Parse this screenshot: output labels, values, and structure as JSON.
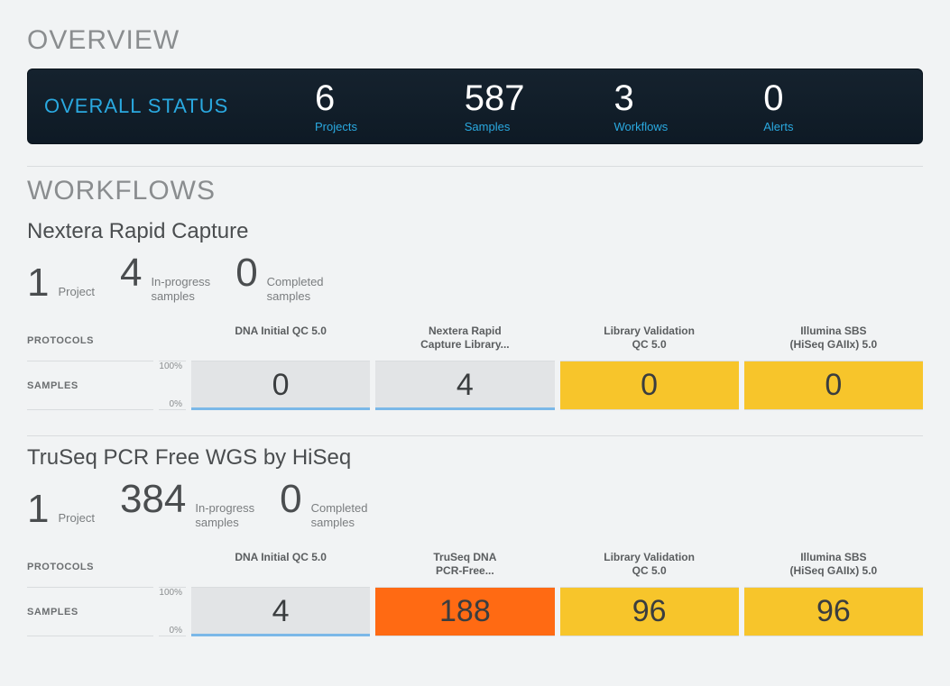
{
  "overview": {
    "title": "OVERVIEW",
    "status_label": "OVERALL STATUS",
    "stats": {
      "projects": {
        "num": "6",
        "cap": "Projects"
      },
      "samples": {
        "num": "587",
        "cap": "Samples"
      },
      "workflows": {
        "num": "3",
        "cap": "Workflows"
      },
      "alerts": {
        "num": "0",
        "cap": "Alerts"
      }
    }
  },
  "workflows_title": "WORKFLOWS",
  "axis": {
    "top": "100%",
    "bottom": "0%"
  },
  "row_labels": {
    "protocols": "PROTOCOLS",
    "samples": "SAMPLES"
  },
  "wf1": {
    "name": "Nextera Rapid Capture",
    "stats": {
      "projects": {
        "num": "1",
        "label": "Project"
      },
      "inprogress": {
        "num": "4",
        "label": "In-progress\nsamples"
      },
      "completed": {
        "num": "0",
        "label": "Completed\nsamples"
      }
    },
    "protocols": {
      "p1": "DNA Initial QC 5.0",
      "p2": "Nextera Rapid\nCapture Library...",
      "p3": "Library Validation\nQC 5.0",
      "p4": "Illumina SBS\n(HiSeq GAIIx) 5.0"
    },
    "values": {
      "v1": "0",
      "v2": "4",
      "v3": "0",
      "v4": "0"
    }
  },
  "wf2": {
    "name": "TruSeq PCR Free WGS by HiSeq",
    "stats": {
      "projects": {
        "num": "1",
        "label": "Project"
      },
      "inprogress": {
        "num": "384",
        "label": "In-progress\nsamples"
      },
      "completed": {
        "num": "0",
        "label": "Completed\nsamples"
      }
    },
    "protocols": {
      "p1": "DNA Initial QC 5.0",
      "p2": "TruSeq DNA\nPCR-Free...",
      "p3": "Library Validation\nQC 5.0",
      "p4": "Illumina SBS\n(HiSeq GAIIx) 5.0"
    },
    "values": {
      "v1": "4",
      "v2": "188",
      "v3": "96",
      "v4": "96"
    }
  },
  "chart_data": [
    {
      "type": "bar",
      "title": "Nextera Rapid Capture — samples per protocol step",
      "categories": [
        "DNA Initial QC 5.0",
        "Nextera Rapid Capture Library...",
        "Library Validation QC 5.0",
        "Illumina SBS (HiSeq GAIIx) 5.0"
      ],
      "values": [
        0,
        4,
        0,
        0
      ],
      "ylabel": "Samples",
      "ylim_pct": [
        0,
        100
      ]
    },
    {
      "type": "bar",
      "title": "TruSeq PCR Free WGS by HiSeq — samples per protocol step",
      "categories": [
        "DNA Initial QC 5.0",
        "TruSeq DNA PCR-Free...",
        "Library Validation QC 5.0",
        "Illumina SBS (HiSeq GAIIx) 5.0"
      ],
      "values": [
        4,
        188,
        96,
        96
      ],
      "ylabel": "Samples",
      "ylim_pct": [
        0,
        100
      ]
    }
  ]
}
